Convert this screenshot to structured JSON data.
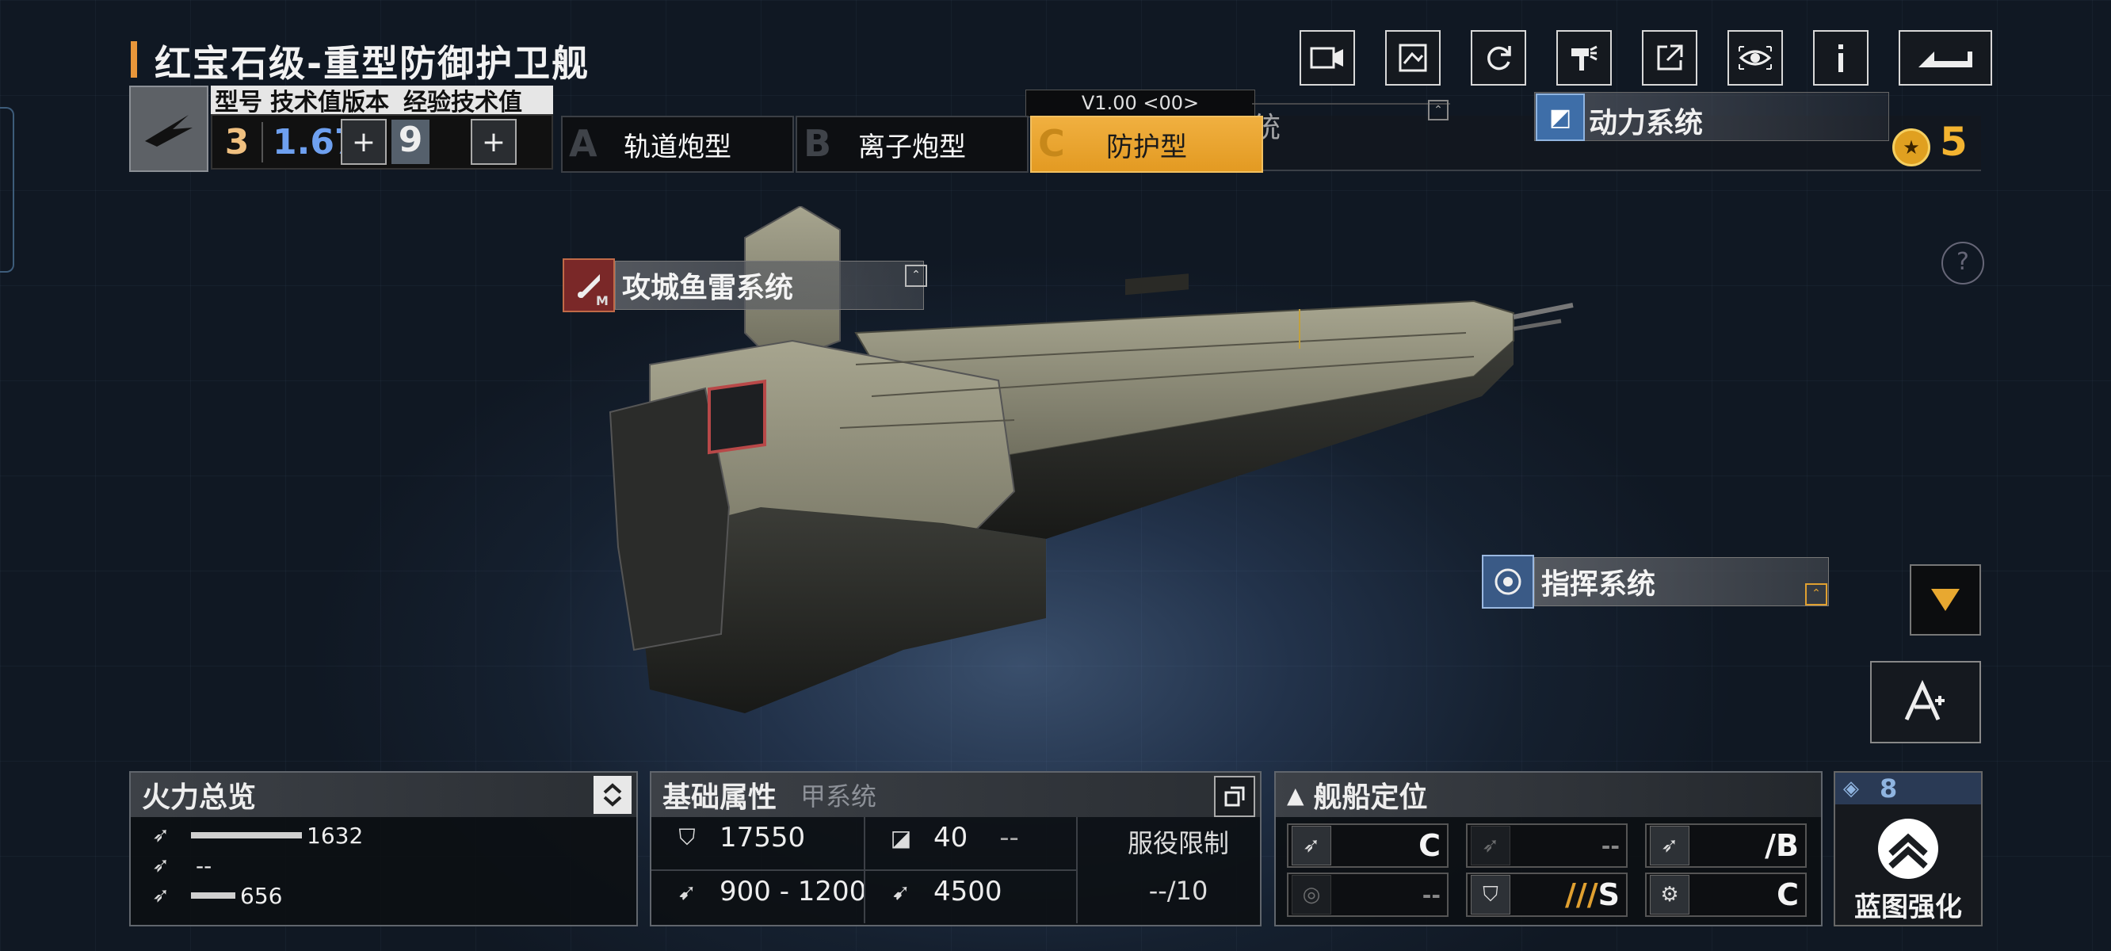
{
  "header": {
    "title": "红宝石级-重型防御护卫舰",
    "stat_labels": {
      "type": "型号",
      "tech": "技术值版本",
      "exp": "经验技术值"
    },
    "type_value": "3",
    "tech_value": "1.67",
    "exp_value": "9",
    "plus": "+"
  },
  "tabs": [
    {
      "letter": "A",
      "label": "轨道炮型"
    },
    {
      "letter": "B",
      "label": "离子炮型"
    },
    {
      "letter": "C",
      "label": "防护型"
    }
  ],
  "version": "V1.00 <00>",
  "ghost_labels": {
    "top": "统",
    "bottom": "甲系统"
  },
  "modules": {
    "power": "动力系统",
    "torpedo": "攻城鱼雷系统",
    "torpedo_badge": "M",
    "command": "指挥系统"
  },
  "reward_value": "5",
  "help": "?",
  "top_icons": [
    "camera-icon",
    "blueprint-icon",
    "refresh-icon",
    "paint-icon",
    "share-icon",
    "eye-icon",
    "info-icon",
    "back-icon"
  ],
  "firepower": {
    "title": "火力总览",
    "rows": [
      {
        "icon": "antiship-icon",
        "value": "1632",
        "ratio": 1.0
      },
      {
        "icon": "antiair-icon",
        "value": "--",
        "ratio": 0
      },
      {
        "icon": "siege-icon",
        "value": "656",
        "ratio": 0.4
      }
    ]
  },
  "attributes": {
    "title": "基础属性",
    "hp": "17550",
    "armor": "40",
    "armor_extra": "--",
    "speed": "900 - 1200",
    "range": "4500",
    "service_limit_label": "服役限制",
    "service_limit_value": "--/10"
  },
  "positioning": {
    "title": "舰船定位",
    "cells": [
      {
        "value": "C",
        "dim": false
      },
      {
        "value": "--",
        "dim": true
      },
      {
        "value": "/B",
        "dim": false
      },
      {
        "value": "--",
        "dim": true
      },
      {
        "value": "S",
        "dim": false,
        "prefix": "///"
      },
      {
        "value": "C",
        "dim": false
      }
    ]
  },
  "blueprint": {
    "count": "8",
    "label": "蓝图强化"
  },
  "colors": {
    "accent": "#e8a23a",
    "blue": "#6ea0f0",
    "panel": "#0c0f13"
  }
}
